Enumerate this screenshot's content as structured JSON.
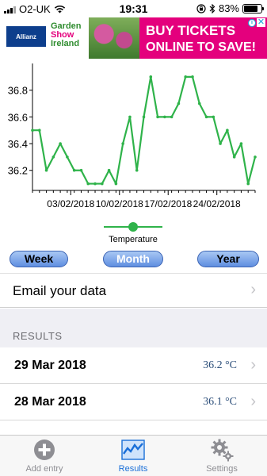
{
  "status_bar": {
    "carrier": "O2-UK",
    "time": "19:31",
    "battery_percent": "83%",
    "battery_level": 0.83
  },
  "ad": {
    "sponsor": "Allianz",
    "event_line1": "Garden",
    "event_line2": "Show",
    "event_line3": "Ireland",
    "headline_line1": "BUY TICKETS",
    "headline_line2": "ONLINE TO SAVE!",
    "info_icon": "info-icon",
    "close_icon": "close-icon"
  },
  "chart_data": {
    "type": "line",
    "series": [
      {
        "name": "",
        "color": "#2fb34a",
        "values": [
          36.5,
          36.5,
          36.2,
          36.3,
          36.4,
          36.3,
          36.2,
          36.2,
          36.1,
          36.1,
          36.1,
          36.2,
          36.1,
          36.4,
          36.6,
          36.2,
          36.6,
          36.9,
          36.6,
          36.6,
          36.6,
          36.7,
          36.9,
          36.9,
          36.7,
          36.6,
          36.6,
          36.4,
          36.5,
          36.3,
          36.4,
          36.1,
          36.3
        ]
      }
    ],
    "x_tick_labels": [
      "03/02/2018",
      "10/02/2018",
      "17/02/2018",
      "24/02/2018"
    ],
    "y_tick_labels": [
      "36.2",
      "36.4",
      "36.6",
      "36.8"
    ],
    "ylim": [
      36.05,
      37.0
    ],
    "legend": {
      "label": "Temperature",
      "placement": "bottom"
    },
    "grid": false
  },
  "range_buttons": {
    "week": "Week",
    "month": "Month",
    "year": "Year",
    "selected": "month"
  },
  "email_row": {
    "label": "Email your data"
  },
  "results": {
    "header": "RESULTS",
    "rows": [
      {
        "date": "29 Mar 2018",
        "value": "36.2 °C"
      },
      {
        "date": "28 Mar 2018",
        "value": "36.1 °C"
      }
    ]
  },
  "tabbar": {
    "add_entry": "Add entry",
    "results": "Results",
    "settings": "Settings",
    "active": "results",
    "active_color": "#1a6fd8"
  }
}
